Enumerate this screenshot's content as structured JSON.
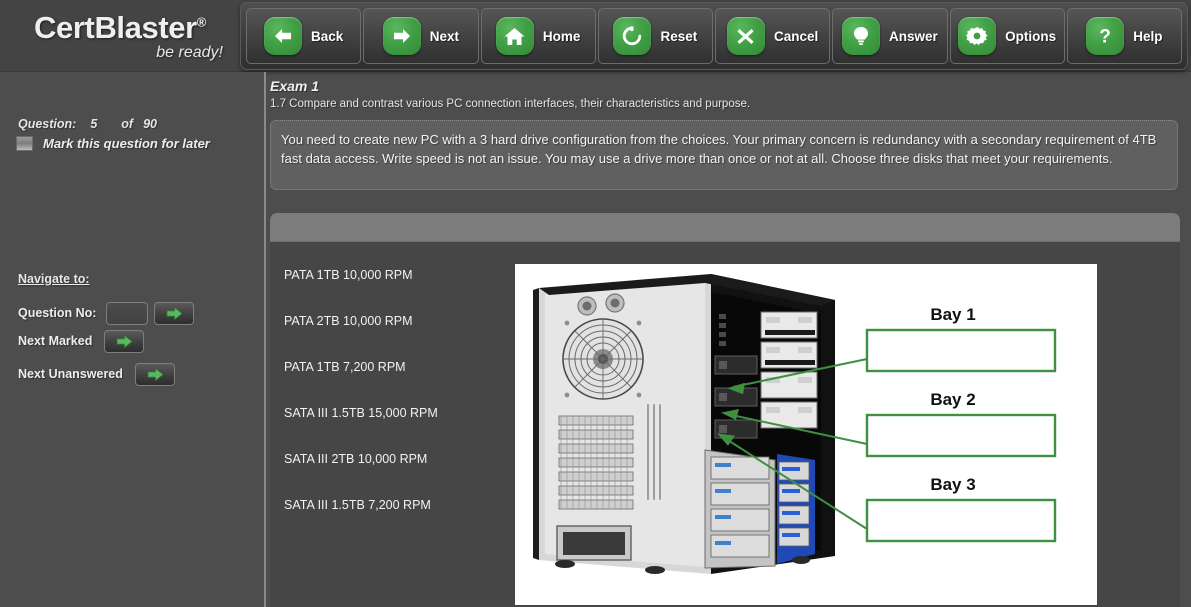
{
  "brand": {
    "name": "CertBlaster",
    "registered": "®",
    "tagline": "be ready!"
  },
  "toolbar": {
    "buttons": [
      {
        "label": "Back",
        "icon": "arrow-left-icon"
      },
      {
        "label": "Next",
        "icon": "arrow-right-icon"
      },
      {
        "label": "Home",
        "icon": "home-icon"
      },
      {
        "label": "Reset",
        "icon": "refresh-icon"
      },
      {
        "label": "Cancel",
        "icon": "close-x-icon"
      },
      {
        "label": "Answer",
        "icon": "lightbulb-icon"
      },
      {
        "label": "Options",
        "icon": "gear-icon"
      },
      {
        "label": "Help",
        "icon": "question-mark-icon"
      }
    ]
  },
  "sidebar": {
    "question_label": "Question:",
    "question_number": "5",
    "of_label": "of",
    "question_total": "90",
    "mark_label": "Mark this question for later",
    "mark_checked": false,
    "navigate_title": "Navigate to:",
    "nav_rows": [
      {
        "label": "Question No:",
        "value": "",
        "placeholder": "",
        "has_input": true,
        "button_icon": "arrow-right-icon"
      },
      {
        "label": "Next Marked",
        "has_input": false,
        "button_icon": "arrow-right-icon"
      },
      {
        "label": "Next Unanswered",
        "has_input": false,
        "button_icon": "arrow-right-icon"
      }
    ]
  },
  "main": {
    "exam_title": "Exam 1",
    "objective": "1.7 Compare and contrast various PC connection interfaces, their characteristics and purpose.",
    "question_text": "You need to create new PC with a 3 hard drive configuration from the choices. Your primary concern is redundancy with a secondary requirement of 4TB fast data access. Write speed is not an issue. You may use a drive more than once or not at all. Choose three disks that meet your requirements.",
    "options": [
      "PATA 1TB 10,000 RPM",
      "PATA 2TB 10,000 RPM",
      "PATA 1TB 7,200 RPM",
      "SATA III 1.5TB 15,000 RPM",
      "SATA III 2TB 10,000 RPM",
      "SATA III 1.5TB 7,200 RPM"
    ],
    "bays": [
      {
        "label": "Bay 1",
        "value": ""
      },
      {
        "label": "Bay 2",
        "value": ""
      },
      {
        "label": "Bay 3",
        "value": ""
      }
    ],
    "image_alt": "computer-case-interior-photo"
  },
  "colors": {
    "accent_green": "#41a045",
    "bay_border": "#3f9142",
    "panel_bg": "#464646",
    "panel_head": "#7c7c7c",
    "page_bg": "#4d4d4d",
    "question_box_bg": "#606060"
  }
}
